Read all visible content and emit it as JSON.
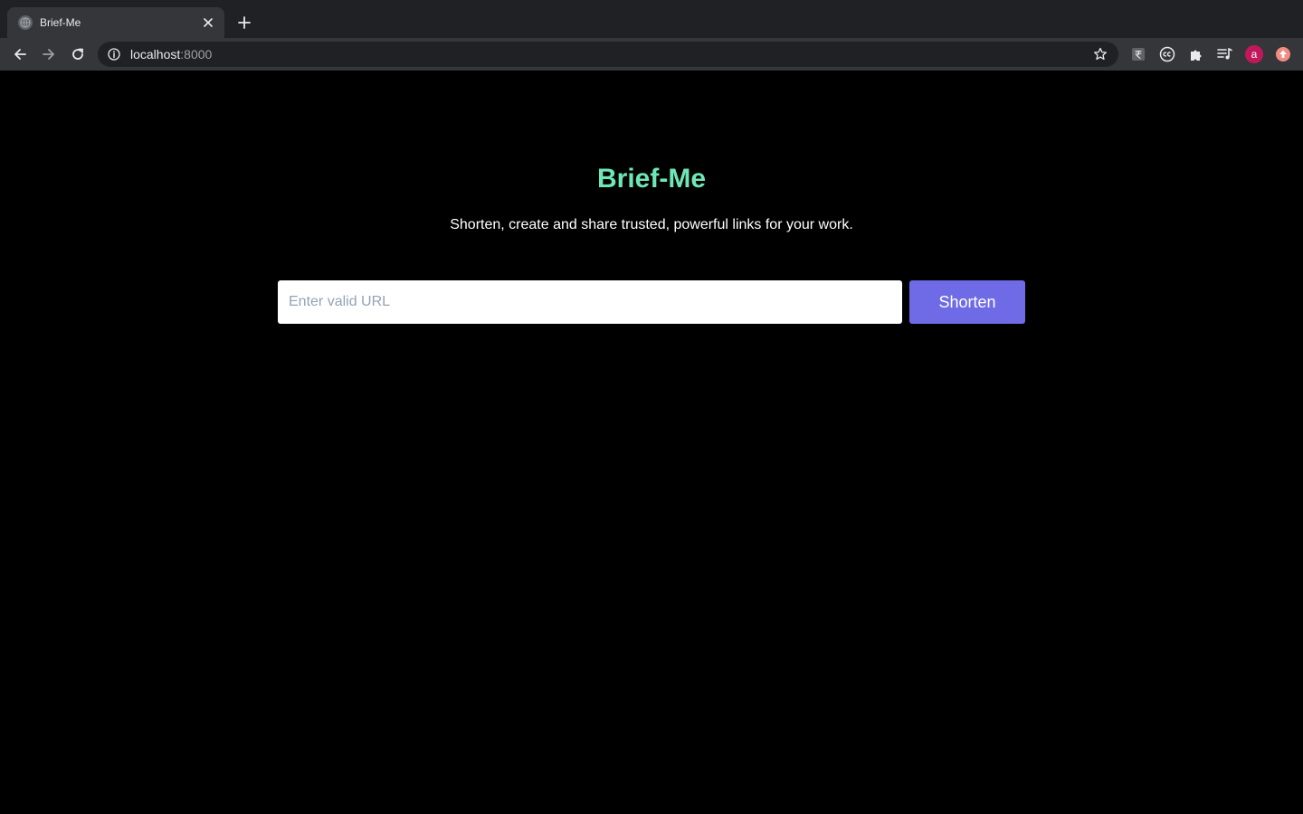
{
  "browser": {
    "tab": {
      "title": "Brief-Me",
      "favicon": "globe-icon",
      "close_icon": "close-icon"
    },
    "new_tab_icon": "plus-icon",
    "nav": {
      "back_icon": "arrow-left-icon",
      "forward_icon": "arrow-right-icon",
      "reload_icon": "reload-icon"
    },
    "address": {
      "host": "localhost",
      "port": ":8000",
      "info_icon": "info-icon",
      "bookmark_icon": "star-icon"
    },
    "extensions": [
      {
        "name": "rupee-extension-icon"
      },
      {
        "name": "cc-extension-icon"
      },
      {
        "name": "puzzle-extensions-icon"
      },
      {
        "name": "media-queue-icon"
      },
      {
        "name": "profile-avatar",
        "label": "a"
      },
      {
        "name": "upload-extension-icon"
      }
    ]
  },
  "page": {
    "title": "Brief-Me",
    "tagline": "Shorten, create and share trusted, powerful links for your work.",
    "url_input": {
      "placeholder": "Enter valid URL",
      "value": ""
    },
    "shorten_label": "Shorten"
  },
  "colors": {
    "background": "#000000",
    "title": "#6ee7b7",
    "button": "#6f6be6",
    "avatar": "#c2185b",
    "upload_extension": "#f28b82"
  }
}
